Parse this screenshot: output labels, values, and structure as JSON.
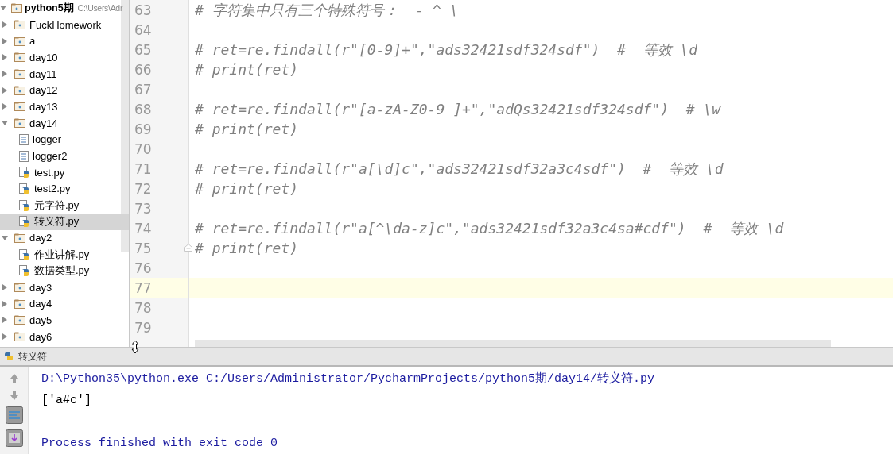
{
  "project_tree": {
    "root": {
      "label": "python5期",
      "path": "C:\\Users\\Adr",
      "expanded": true
    },
    "items": [
      {
        "label": "FuckHomework",
        "kind": "folder",
        "expanded": false,
        "selected": false
      },
      {
        "label": "a",
        "kind": "folder",
        "expanded": false,
        "selected": false
      },
      {
        "label": "day10",
        "kind": "folder",
        "expanded": false,
        "selected": false
      },
      {
        "label": "day11",
        "kind": "folder",
        "expanded": false,
        "selected": false
      },
      {
        "label": "day12",
        "kind": "folder",
        "expanded": false,
        "selected": false
      },
      {
        "label": "day13",
        "kind": "folder",
        "expanded": false,
        "selected": false
      },
      {
        "label": "day14",
        "kind": "folder",
        "expanded": true,
        "selected": false,
        "children": [
          {
            "label": "logger",
            "kind": "text",
            "selected": false
          },
          {
            "label": "logger2",
            "kind": "text",
            "selected": false
          },
          {
            "label": "test.py",
            "kind": "python",
            "selected": false
          },
          {
            "label": "test2.py",
            "kind": "python",
            "selected": false
          },
          {
            "label": "元字符.py",
            "kind": "python",
            "selected": false
          },
          {
            "label": "转义符.py",
            "kind": "python",
            "selected": true
          }
        ]
      },
      {
        "label": "day2",
        "kind": "folder",
        "expanded": true,
        "selected": false,
        "children": [
          {
            "label": "作业讲解.py",
            "kind": "python",
            "selected": false
          },
          {
            "label": "数据类型.py",
            "kind": "python",
            "selected": false
          }
        ]
      },
      {
        "label": "day3",
        "kind": "folder",
        "expanded": false,
        "selected": false
      },
      {
        "label": "day4",
        "kind": "folder",
        "expanded": false,
        "selected": false
      },
      {
        "label": "day5",
        "kind": "folder",
        "expanded": false,
        "selected": false
      },
      {
        "label": "day6",
        "kind": "folder",
        "expanded": false,
        "selected": false
      }
    ]
  },
  "editor": {
    "lines": [
      {
        "number": "63",
        "text": "# 字符集中只有三个特殊符号：  - ^ \\",
        "current": false,
        "fold_marker": false
      },
      {
        "number": "64",
        "current": false,
        "fold_marker": false
      },
      {
        "number": "65",
        "text": "# ret=re.findall(r\"[0-9]+\",\"ads32421sdf324sdf\")  #  等效 \\d",
        "current": false,
        "fold_marker": false
      },
      {
        "number": "66",
        "text": "# print(ret)",
        "current": false,
        "fold_marker": false
      },
      {
        "number": "67",
        "current": false,
        "fold_marker": false
      },
      {
        "number": "68",
        "text": "# ret=re.findall(r\"[a-zA-Z0-9_]+\",\"adQs32421sdf324sdf\")  # \\w",
        "current": false,
        "fold_marker": false
      },
      {
        "number": "69",
        "text": "# print(ret)",
        "current": false,
        "fold_marker": false
      },
      {
        "number": "70",
        "current": false,
        "fold_marker": false
      },
      {
        "number": "71",
        "text": "# ret=re.findall(r\"a[\\d]c\",\"ads32421sdf32a3c4sdf\")  #  等效 \\d",
        "current": false,
        "fold_marker": false
      },
      {
        "number": "72",
        "text": "# print(ret)",
        "current": false,
        "fold_marker": false
      },
      {
        "number": "73",
        "current": false,
        "fold_marker": false
      },
      {
        "number": "74",
        "text": "# ret=re.findall(r\"a[^\\da-z]c\",\"ads32421sdf32a3c4sa#cdf\")  #  等效 \\d",
        "current": false,
        "fold_marker": false
      },
      {
        "number": "75",
        "text": "# print(ret)",
        "current": false,
        "fold_marker": true
      },
      {
        "number": "76",
        "current": false,
        "fold_marker": false
      },
      {
        "number": "77",
        "current": true,
        "fold_marker": false
      },
      {
        "number": "78",
        "current": false,
        "fold_marker": false
      },
      {
        "number": "79",
        "current": false,
        "fold_marker": false
      }
    ]
  },
  "run_panel": {
    "tab": "转义符",
    "command": "D:\\Python35\\python.exe C:/Users/Administrator/PycharmProjects/python5期/day14/转义符.py",
    "output": [
      "['a#c']"
    ],
    "exit_message": "Process finished with exit code 0"
  }
}
